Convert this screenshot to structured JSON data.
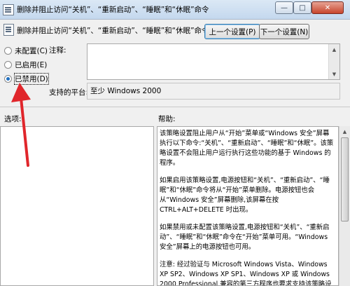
{
  "window": {
    "title": "删除并阻止访问“关机”、“重新启动”、“睡眠”和“休眠”命令",
    "controls": {
      "minimize": "—",
      "maximize": "□",
      "close": "✕"
    }
  },
  "header": {
    "policy_name": "删除并阻止访问“关机”、“重新启动”、“睡眠”和“休眠”命令",
    "prev_button": "上一个设置(P)",
    "next_button": "下一个设置(N)"
  },
  "state_options": [
    {
      "label": "未配置(C)",
      "selected": false
    },
    {
      "label": "已启用(E)",
      "selected": false
    },
    {
      "label": "已禁用(D)",
      "selected": true
    }
  ],
  "comment": {
    "label": "注释:",
    "value": ""
  },
  "supported_on": {
    "label": "支持的平台:",
    "value": "至少 Windows 2000"
  },
  "options_label": "选项:",
  "help_label": "帮助:",
  "help_paragraphs": [
    "该策略设置阻止用户从“开始”菜单或“Windows 安全”屏幕执行以下命令:“关机”、“重新启动”、“睡眠”和“休眠”。该策略设置不会阻止用户运行执行这些功能的基于 Windows 的程序。",
    "如果启用该策略设置,电源按钮和“关机”、“重新启动”、“睡眠”和“休眠”命令将从“开始”菜单删除。电源按钮也会从“Windows 安全”屏幕删除,该屏幕在按 CTRL+ALT+DELETE 时出现。",
    "如果禁用或未配置该策略设置,电源按钮和“关机”、“重新启动”、“睡眠”和“休眠”命令在“开始”菜单可用。“Windows 安全”屏幕上的电源按钮也可用。",
    "注意: 经过验证与 Microsoft Windows Vista、Windows XP SP2、Windows XP SP1、Windows XP 或 Windows 2000 Professional 兼容的第三方程序也要求支持该策略设置。"
  ],
  "colors": {
    "annotation_arrow": "#e0262b",
    "selection_dot": "#1f6fc0"
  },
  "icons": [
    "policy-icon",
    "minimize-icon",
    "maximize-icon",
    "close-icon",
    "scroll-up-icon",
    "scroll-down-icon"
  ]
}
